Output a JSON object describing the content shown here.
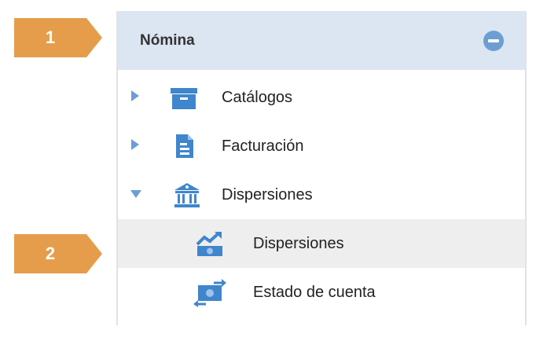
{
  "callouts": [
    {
      "number": "1",
      "color": "#e59d4c"
    },
    {
      "number": "2",
      "color": "#e59d4c"
    }
  ],
  "menu": {
    "title": "Nómina",
    "header_color": "#dbe6f2",
    "accent_color": "#6d9ed3",
    "items": [
      {
        "label": "Catálogos",
        "icon": "archive-box-icon",
        "toggle": "collapsed",
        "level": 1
      },
      {
        "label": "Facturación",
        "icon": "document-icon",
        "toggle": "collapsed",
        "level": 1
      },
      {
        "label": "Dispersiones",
        "icon": "bank-icon",
        "toggle": "expanded",
        "level": 1
      },
      {
        "label": "Dispersiones",
        "icon": "money-chart-icon",
        "level": 2,
        "active": true
      },
      {
        "label": "Estado de cuenta",
        "icon": "money-exchange-icon",
        "level": 2
      }
    ]
  }
}
